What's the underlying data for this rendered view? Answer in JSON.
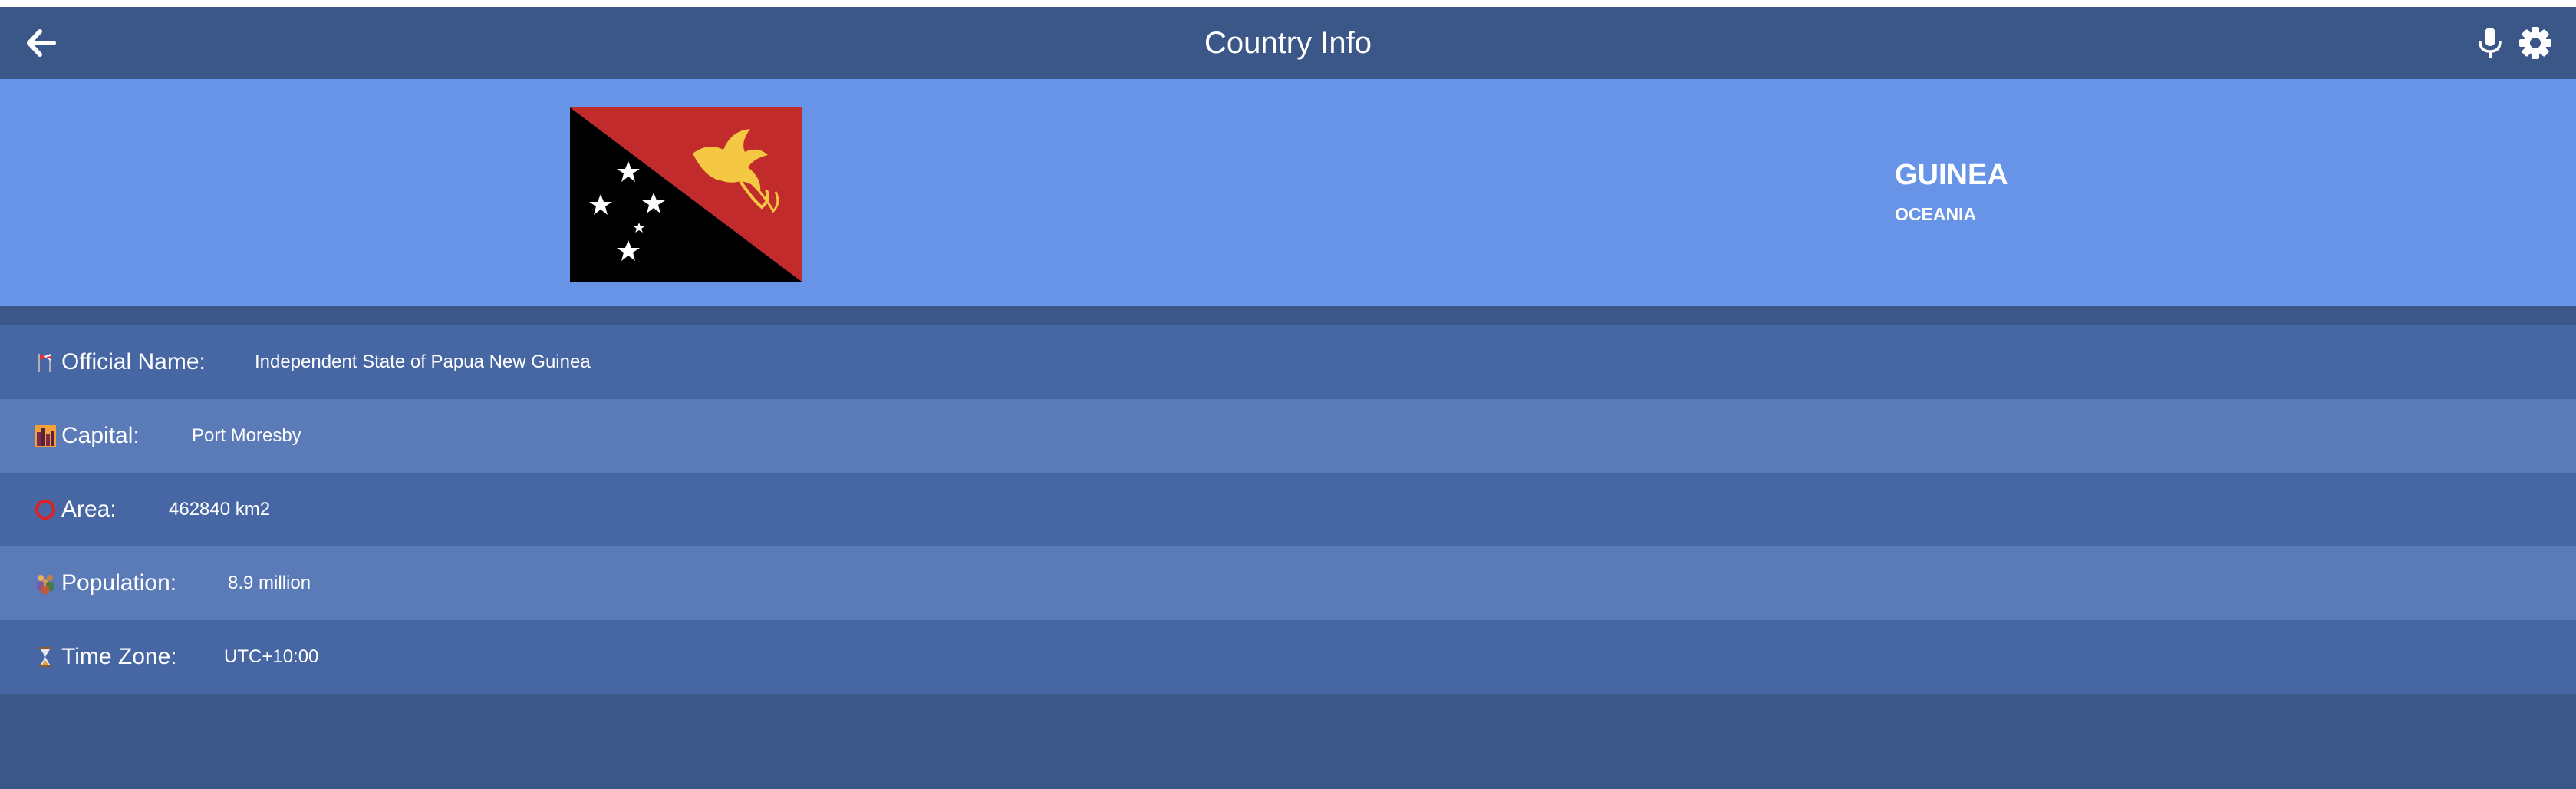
{
  "appbar": {
    "title": "Country Info",
    "icons": [
      "arrow-left-icon",
      "microphone-icon",
      "gear-icon"
    ]
  },
  "country": {
    "name": "GUINEA",
    "region": "OCEANIA",
    "flag_colors": {
      "red": "#c12b2b",
      "black": "#000000",
      "gold": "#f4c842",
      "white": "#ffffff"
    }
  },
  "details": [
    {
      "icon": "flags-icon",
      "label": "Official Name:",
      "value": "Independent State of Papua New Guinea"
    },
    {
      "icon": "city-icon",
      "label": "Capital:",
      "value": "Port Moresby"
    },
    {
      "icon": "circle-icon",
      "label": "Area:",
      "value": "462840  km2"
    },
    {
      "icon": "people-icon",
      "label": "Population:",
      "value": "8.9  million"
    },
    {
      "icon": "hourglass-icon",
      "label": "Time Zone:",
      "value": "UTC+10:00"
    }
  ],
  "colors": {
    "appbar": "#3b5788",
    "hero": "#6894e8",
    "row_odd": "#4766a4",
    "row_even": "#5a7bb8"
  }
}
